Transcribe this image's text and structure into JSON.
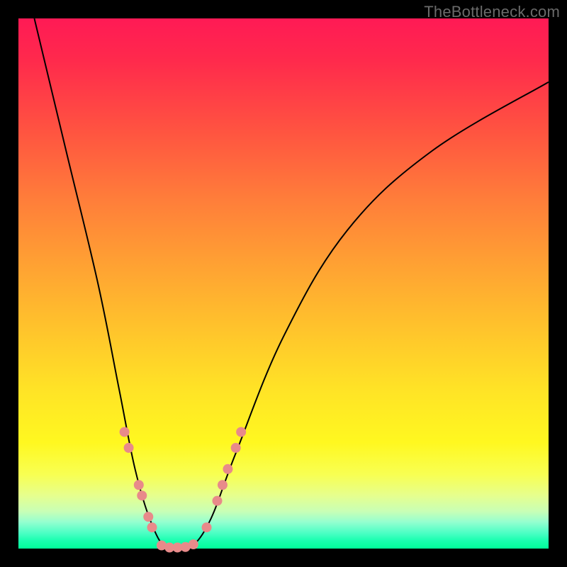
{
  "watermark": "TheBottleneck.com",
  "colors": {
    "dot": "#e88a8a",
    "curve": "#000000",
    "frame_bg_top": "#ff1a55",
    "frame_bg_bottom": "#00ff99",
    "page_bg": "#000000"
  },
  "chart_data": {
    "type": "line",
    "title": "",
    "xlabel": "",
    "ylabel": "",
    "xlim": [
      0,
      100
    ],
    "ylim": [
      0,
      100
    ],
    "series": [
      {
        "name": "bottleneck-curve",
        "points": [
          {
            "x": 3,
            "y": 100
          },
          {
            "x": 9,
            "y": 75
          },
          {
            "x": 15,
            "y": 50
          },
          {
            "x": 19,
            "y": 30
          },
          {
            "x": 22,
            "y": 15
          },
          {
            "x": 25,
            "y": 5
          },
          {
            "x": 28,
            "y": 0
          },
          {
            "x": 32,
            "y": 0
          },
          {
            "x": 36,
            "y": 5
          },
          {
            "x": 41,
            "y": 18
          },
          {
            "x": 50,
            "y": 40
          },
          {
            "x": 62,
            "y": 60
          },
          {
            "x": 78,
            "y": 75
          },
          {
            "x": 100,
            "y": 88
          }
        ]
      }
    ],
    "markers": [
      {
        "x": 20.0,
        "y": 22
      },
      {
        "x": 20.8,
        "y": 19
      },
      {
        "x": 22.7,
        "y": 12
      },
      {
        "x": 23.3,
        "y": 10
      },
      {
        "x": 24.5,
        "y": 6
      },
      {
        "x": 25.2,
        "y": 4
      },
      {
        "x": 27.0,
        "y": 0.6
      },
      {
        "x": 28.5,
        "y": 0.2
      },
      {
        "x": 30.0,
        "y": 0.2
      },
      {
        "x": 31.5,
        "y": 0.3
      },
      {
        "x": 33.0,
        "y": 0.8
      },
      {
        "x": 35.5,
        "y": 4
      },
      {
        "x": 37.5,
        "y": 9
      },
      {
        "x": 38.5,
        "y": 12
      },
      {
        "x": 39.5,
        "y": 15
      },
      {
        "x": 41.0,
        "y": 19
      },
      {
        "x": 42.0,
        "y": 22
      }
    ]
  }
}
